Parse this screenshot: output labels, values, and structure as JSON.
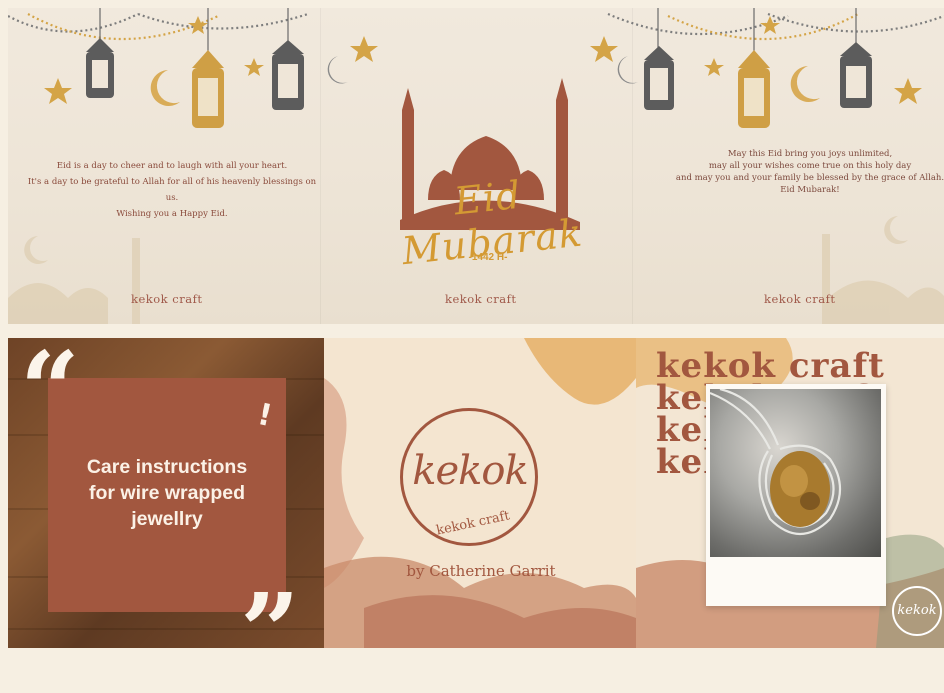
{
  "banner": {
    "left_message": [
      "Eid is a day to cheer and to laugh with all your heart.",
      "It's a day to be grateful to Allah for all of his heavenly blessings on us.",
      "Wishing you a Happy Eid."
    ],
    "right_message": [
      "May this Eid bring you joys unlimited,",
      "may all your wishes come true on this holy day",
      "and may you and your family be blessed by the grace of Allah.",
      "Eid Mubarak!"
    ],
    "title": "Eid Mubarak",
    "hijri_year": "-1442 H-",
    "brand_left": "kekok craft",
    "brand_center": "kekok craft",
    "brand_right": "kekok craft",
    "colors": {
      "accent": "#d49a33",
      "mosque": "#a2573f",
      "lantern_dark": "#5a5a5a"
    }
  },
  "care_panel": {
    "title_line1": "Care instructions",
    "title_line2": "for wire wrapped",
    "title_line3": "jewellry",
    "alert_mark": "!",
    "open_quote": "“",
    "close_quote": "”"
  },
  "logo_panel": {
    "logo_word": "kekok",
    "logo_sub": "kekok craft",
    "byline": "by Catherine Garrit"
  },
  "photo_panel": {
    "brand_lines": [
      "kekok craft",
      "kekok craft",
      "kekok craft",
      "kekok craft"
    ],
    "stamp_text": "kekok"
  }
}
